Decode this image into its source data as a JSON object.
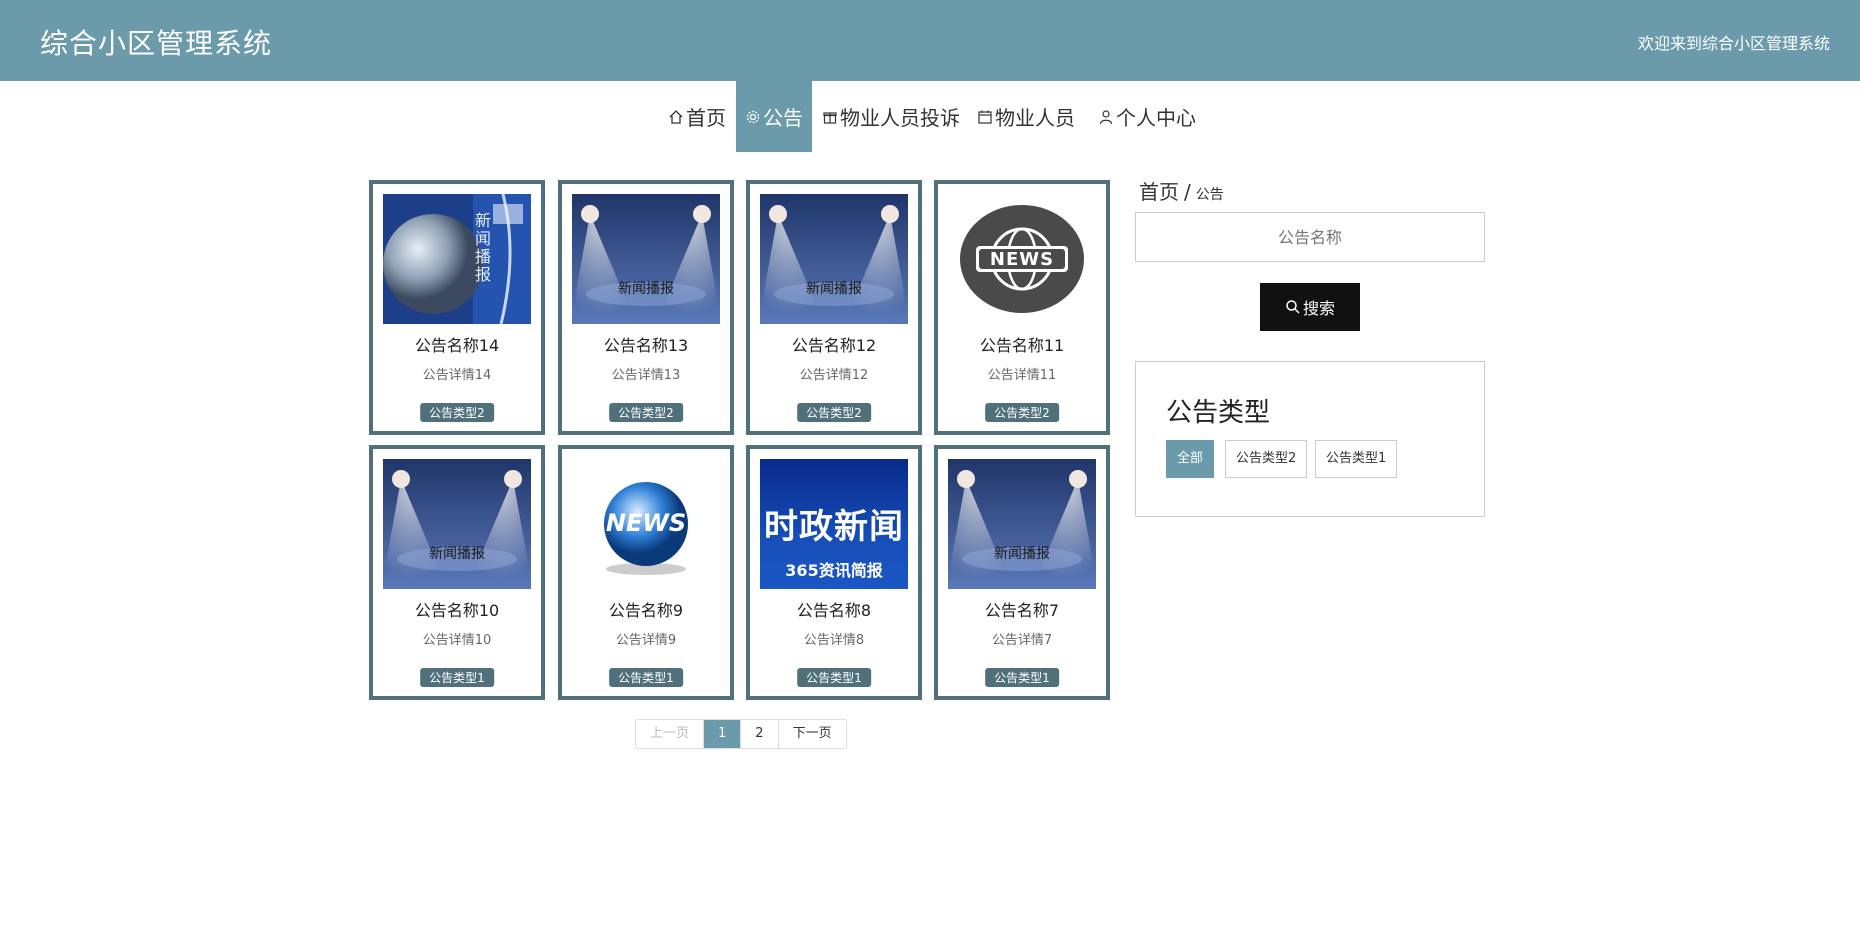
{
  "header": {
    "title": "综合小区管理系统",
    "welcome": "欢迎来到综合小区管理系统"
  },
  "nav": {
    "items": [
      {
        "label": "首页",
        "icon": "home-icon"
      },
      {
        "label": "公告",
        "icon": "gear-icon",
        "active": true
      },
      {
        "label": "物业人员投诉",
        "icon": "gift-icon"
      },
      {
        "label": "物业人员",
        "icon": "calendar-icon"
      },
      {
        "label": "个人中心",
        "icon": "user-icon"
      }
    ]
  },
  "notices": [
    {
      "title": "公告名称14",
      "detail": "公告详情14",
      "type": "公告类型2",
      "image": "globe-broadcast",
      "image_text": "新闻播报"
    },
    {
      "title": "公告名称13",
      "detail": "公告详情13",
      "type": "公告类型2",
      "image": "stage-spotlights",
      "image_text": "新闻播报"
    },
    {
      "title": "公告名称12",
      "detail": "公告详情12",
      "type": "公告类型2",
      "image": "stage-spotlights",
      "image_text": "新闻播报"
    },
    {
      "title": "公告名称11",
      "detail": "公告详情11",
      "type": "公告类型2",
      "image": "news-globe-badge",
      "image_text": "NEWS"
    },
    {
      "title": "公告名称10",
      "detail": "公告详情10",
      "type": "公告类型1",
      "image": "stage-spotlights",
      "image_text": "新闻播报"
    },
    {
      "title": "公告名称9",
      "detail": "公告详情9",
      "type": "公告类型1",
      "image": "news-3d-globe",
      "image_text": "NEWS"
    },
    {
      "title": "公告名称8",
      "detail": "公告详情8",
      "type": "公告类型1",
      "image": "politics-news-banner",
      "image_text": "时政新闻",
      "image_subtext": "365资讯简报"
    },
    {
      "title": "公告名称7",
      "detail": "公告详情7",
      "type": "公告类型1",
      "image": "stage-spotlights",
      "image_text": "新闻播报"
    }
  ],
  "pagination": {
    "prev": "上一页",
    "pages": [
      "1",
      "2"
    ],
    "current": "1",
    "next": "下一页"
  },
  "breadcrumb": {
    "home": "首页",
    "separator": "/",
    "current": "公告"
  },
  "search": {
    "placeholder": "公告名称",
    "button": "搜索"
  },
  "types": {
    "heading": "公告类型",
    "options": [
      "全部",
      "公告类型2",
      "公告类型1"
    ],
    "selected": "全部"
  },
  "colors": {
    "primary": "#6b9aab",
    "card_border": "#50707c",
    "button_dark": "#111111"
  }
}
